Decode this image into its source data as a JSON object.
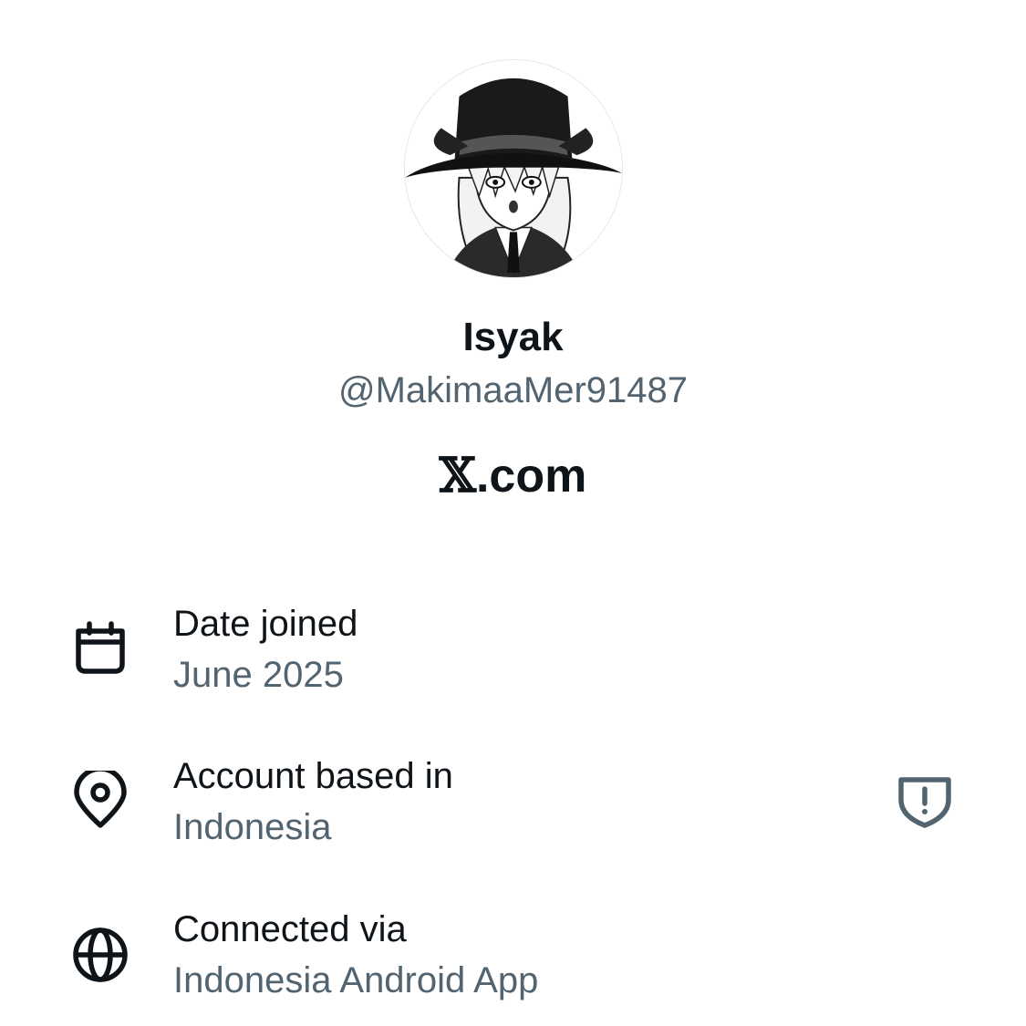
{
  "profile": {
    "display_name": "Isyak",
    "handle": "@MakimaaMer91487"
  },
  "brand": {
    "mark": "𝕏",
    "suffix": ".com"
  },
  "details": [
    {
      "title": "Date joined",
      "value": "June 2025",
      "icon": "calendar-icon"
    },
    {
      "title": "Account based in",
      "value": "Indonesia",
      "icon": "location-pin-icon",
      "trailing_icon": "shield-alert-icon"
    },
    {
      "title": "Connected via",
      "value": "Indonesia Android App",
      "icon": "globe-icon"
    }
  ],
  "colors": {
    "primary_text": "#0f1419",
    "secondary_text": "#536471",
    "background": "#ffffff"
  }
}
